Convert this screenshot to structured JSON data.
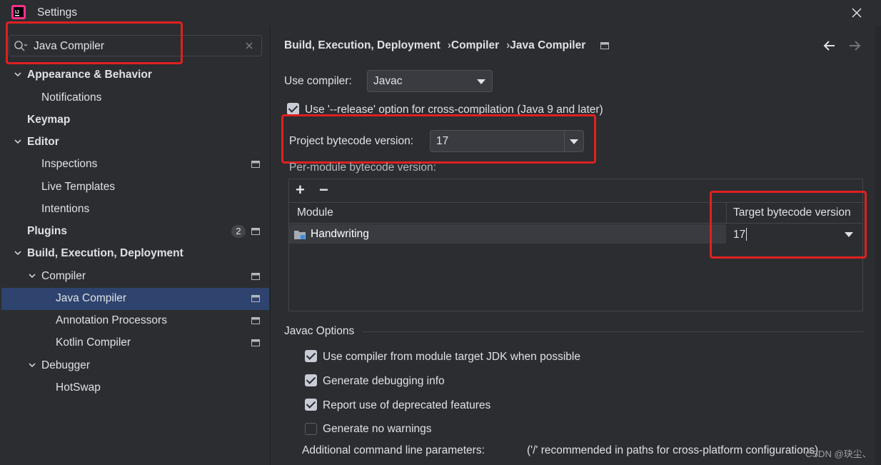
{
  "window": {
    "title": "Settings"
  },
  "search": {
    "value": "Java Compiler"
  },
  "sidebar": {
    "items": [
      {
        "label": "Appearance & Behavior"
      },
      {
        "label": "Notifications"
      },
      {
        "label": "Keymap"
      },
      {
        "label": "Editor"
      },
      {
        "label": "Inspections"
      },
      {
        "label": "Live Templates"
      },
      {
        "label": "Intentions"
      },
      {
        "label": "Plugins",
        "badge": "2"
      },
      {
        "label": "Build, Execution, Deployment"
      },
      {
        "label": "Compiler"
      },
      {
        "label": "Java Compiler"
      },
      {
        "label": "Annotation Processors"
      },
      {
        "label": "Kotlin Compiler"
      },
      {
        "label": "Debugger"
      },
      {
        "label": "HotSwap"
      }
    ]
  },
  "breadcrumb": {
    "parts": [
      "Build, Execution, Deployment",
      "Compiler",
      "Java Compiler"
    ],
    "separator": "›"
  },
  "compiler": {
    "use_label": "Use compiler:",
    "use_value": "Javac",
    "release_label": "Use '--release' option for cross-compilation (Java 9 and later)",
    "release_checked": true,
    "project_label": "Project bytecode version:",
    "project_value": "17",
    "per_module_label": "Per-module bytecode version:"
  },
  "module_table": {
    "add": "+",
    "remove": "−",
    "headers": [
      "Module",
      "Target bytecode version"
    ],
    "rows": [
      {
        "module": "Handwriting",
        "target": "17"
      }
    ]
  },
  "javac_options": {
    "title": "Javac Options",
    "options": [
      {
        "label": "Use compiler from module target JDK when possible",
        "checked": true
      },
      {
        "label": "Generate debugging info",
        "checked": true
      },
      {
        "label": "Report use of deprecated features",
        "checked": true
      },
      {
        "label": "Generate no warnings",
        "checked": false
      }
    ],
    "additional_label": "Additional command line parameters:",
    "additional_placeholder": "('/' recommended in paths for cross-platform configurations)"
  },
  "watermark": "CSDN @玦尘、",
  "colors": {
    "highlight": "#e02020",
    "selection": "#2e436e",
    "background": "#2b2d30"
  }
}
